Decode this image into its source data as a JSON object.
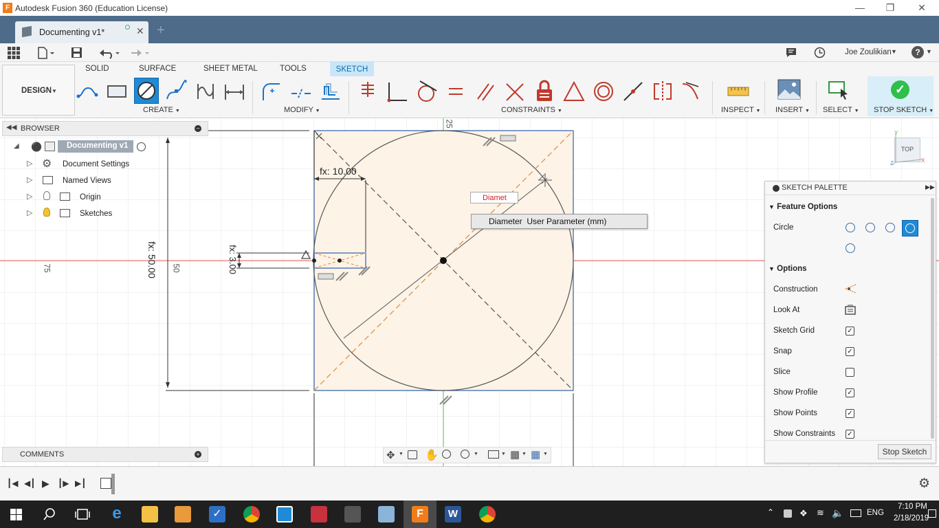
{
  "window": {
    "title": "Autodesk Fusion 360 (Education License)"
  },
  "doc_tab": {
    "label": "Documenting v1*"
  },
  "user": {
    "name": "Joe Zoulikian"
  },
  "workspace": {
    "label": "DESIGN"
  },
  "ribbon": {
    "tabs": [
      "SOLID",
      "SURFACE",
      "SHEET METAL",
      "TOOLS",
      "SKETCH"
    ],
    "active_tab": "SKETCH",
    "groups": {
      "create": "CREATE",
      "modify": "MODIFY",
      "constraints": "CONSTRAINTS",
      "inspect": "INSPECT",
      "insert": "INSERT",
      "select": "SELECT",
      "stop": "STOP SKETCH"
    }
  },
  "browser": {
    "title": "BROWSER",
    "items": [
      "Documenting v1",
      "Document Settings",
      "Named Views",
      "Origin",
      "Sketches"
    ]
  },
  "comments": {
    "title": "COMMENTS"
  },
  "sketch": {
    "dim_width": "fx: 10.00",
    "dim_height": "fx: 50.00",
    "dim_small": "fx: 3.00",
    "label_25": "25",
    "label_50": "50",
    "label_75": "75",
    "dim_input": "Diamet",
    "autocomplete_name": "Diameter",
    "autocomplete_desc": "User Parameter (mm)"
  },
  "viewcube": {
    "label": "TOP"
  },
  "palette": {
    "title": "SKETCH PALETTE",
    "feature_options": "Feature Options",
    "circle": "Circle",
    "options": "Options",
    "rows": [
      {
        "label": "Construction"
      },
      {
        "label": "Look At"
      },
      {
        "label": "Sketch Grid",
        "checked": "✓"
      },
      {
        "label": "Snap",
        "checked": "✓"
      },
      {
        "label": "Slice",
        "checked": ""
      },
      {
        "label": "Show Profile",
        "checked": "✓"
      },
      {
        "label": "Show Points",
        "checked": "✓"
      },
      {
        "label": "Show Constraints",
        "checked": "✓"
      }
    ],
    "stop_button": "Stop Sketch"
  },
  "taskbar": {
    "time": "7:10 PM",
    "date": "2/18/2019",
    "lang": "ENG"
  },
  "colors": {
    "accent": "#0696d7",
    "tabbar": "#4e6b8a",
    "sketch_fill": "#fdf3e7",
    "stop_green": "#2fbf4a"
  }
}
